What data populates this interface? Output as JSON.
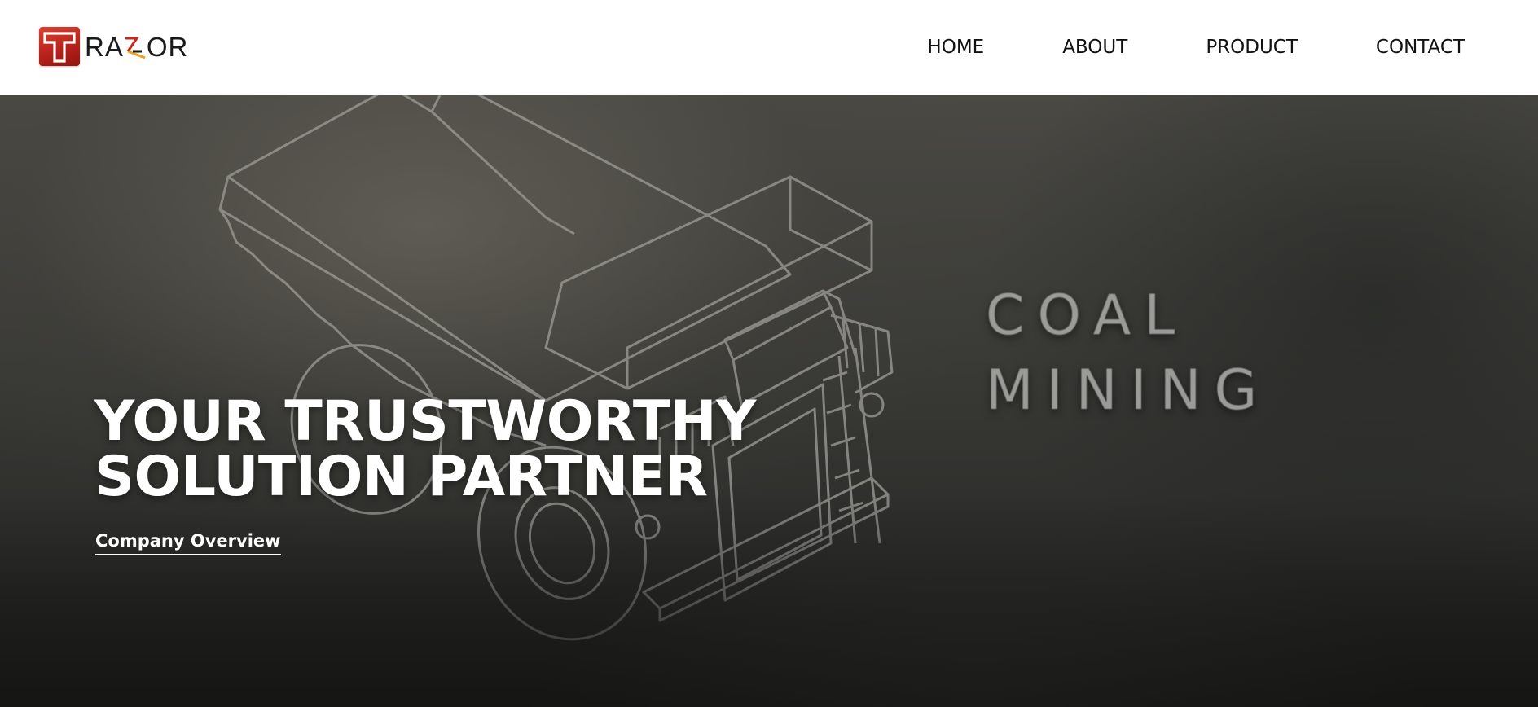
{
  "brand": {
    "logo_letter": "T",
    "logo_wordmark": "RAZOR",
    "logo_icon": "razor-t-logo-icon",
    "colors": {
      "logo_red": "#c9261e",
      "logo_accent": "#f0a020"
    }
  },
  "nav": {
    "items": [
      {
        "label": "HOME"
      },
      {
        "label": "ABOUT"
      },
      {
        "label": "PRODUCT"
      },
      {
        "label": "CONTACT"
      }
    ]
  },
  "hero": {
    "headline_line1": "YOUR TRUSTWORTHY",
    "headline_line2": "SOLUTION PARTNER",
    "cta_label": "Company Overview",
    "background_label_line1": "COAL",
    "background_label_line2": "MINING",
    "background_icon": "mining-dump-truck-illustration"
  }
}
